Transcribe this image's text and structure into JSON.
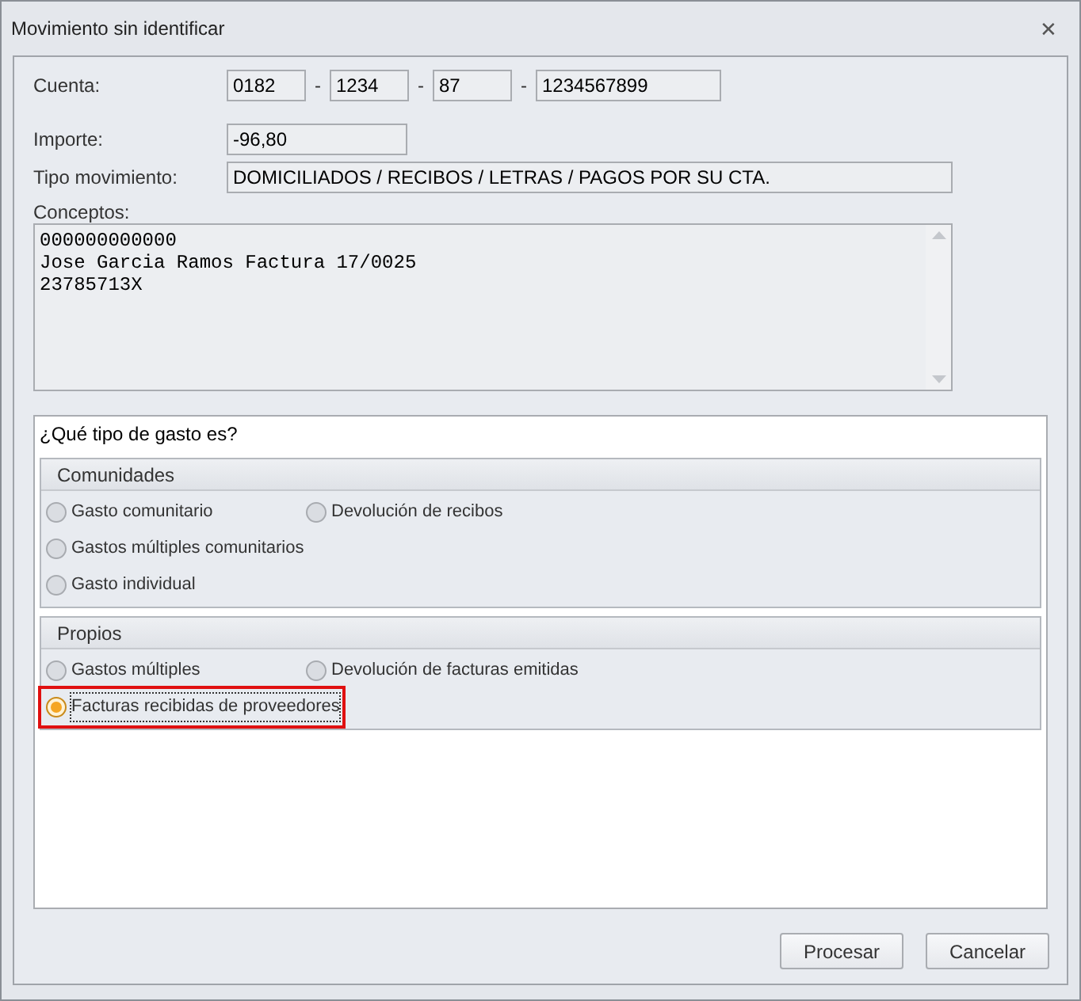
{
  "window": {
    "title": "Movimiento sin identificar",
    "close": "✕"
  },
  "cuenta": {
    "label": "Cuenta:",
    "separator": "-",
    "parts": [
      "0182",
      "1234",
      "87",
      "1234567899"
    ]
  },
  "importe": {
    "label": "Importe:",
    "value": "-96,80"
  },
  "tipo_movimiento": {
    "label": "Tipo movimiento:",
    "value": "DOMICILIADOS / RECIBOS / LETRAS / PAGOS POR SU CTA."
  },
  "conceptos": {
    "label": "Conceptos:",
    "lines": [
      "000000000000",
      "Jose Garcia Ramos Factura 17/0025",
      "23785713X"
    ]
  },
  "question": "¿Qué tipo de gasto es?",
  "groups": [
    {
      "title": "Comunidades",
      "rows": [
        [
          {
            "label": "Gasto comunitario",
            "selected": false,
            "highlighted": false
          },
          {
            "label": "Devolución de recibos",
            "selected": false,
            "highlighted": false
          }
        ],
        [
          {
            "label": "Gastos múltiples comunitarios",
            "selected": false,
            "highlighted": false
          }
        ],
        [
          {
            "label": "Gasto individual",
            "selected": false,
            "highlighted": false
          }
        ]
      ]
    },
    {
      "title": "Propios",
      "rows": [
        [
          {
            "label": "Gastos múltiples",
            "selected": false,
            "highlighted": false
          },
          {
            "label": "Devolución de facturas emitidas",
            "selected": false,
            "highlighted": false
          }
        ],
        [
          {
            "label": "Facturas recibidas de proveedores",
            "selected": true,
            "highlighted": true
          }
        ]
      ]
    }
  ],
  "buttons": [
    "Procesar",
    "Cancelar"
  ]
}
